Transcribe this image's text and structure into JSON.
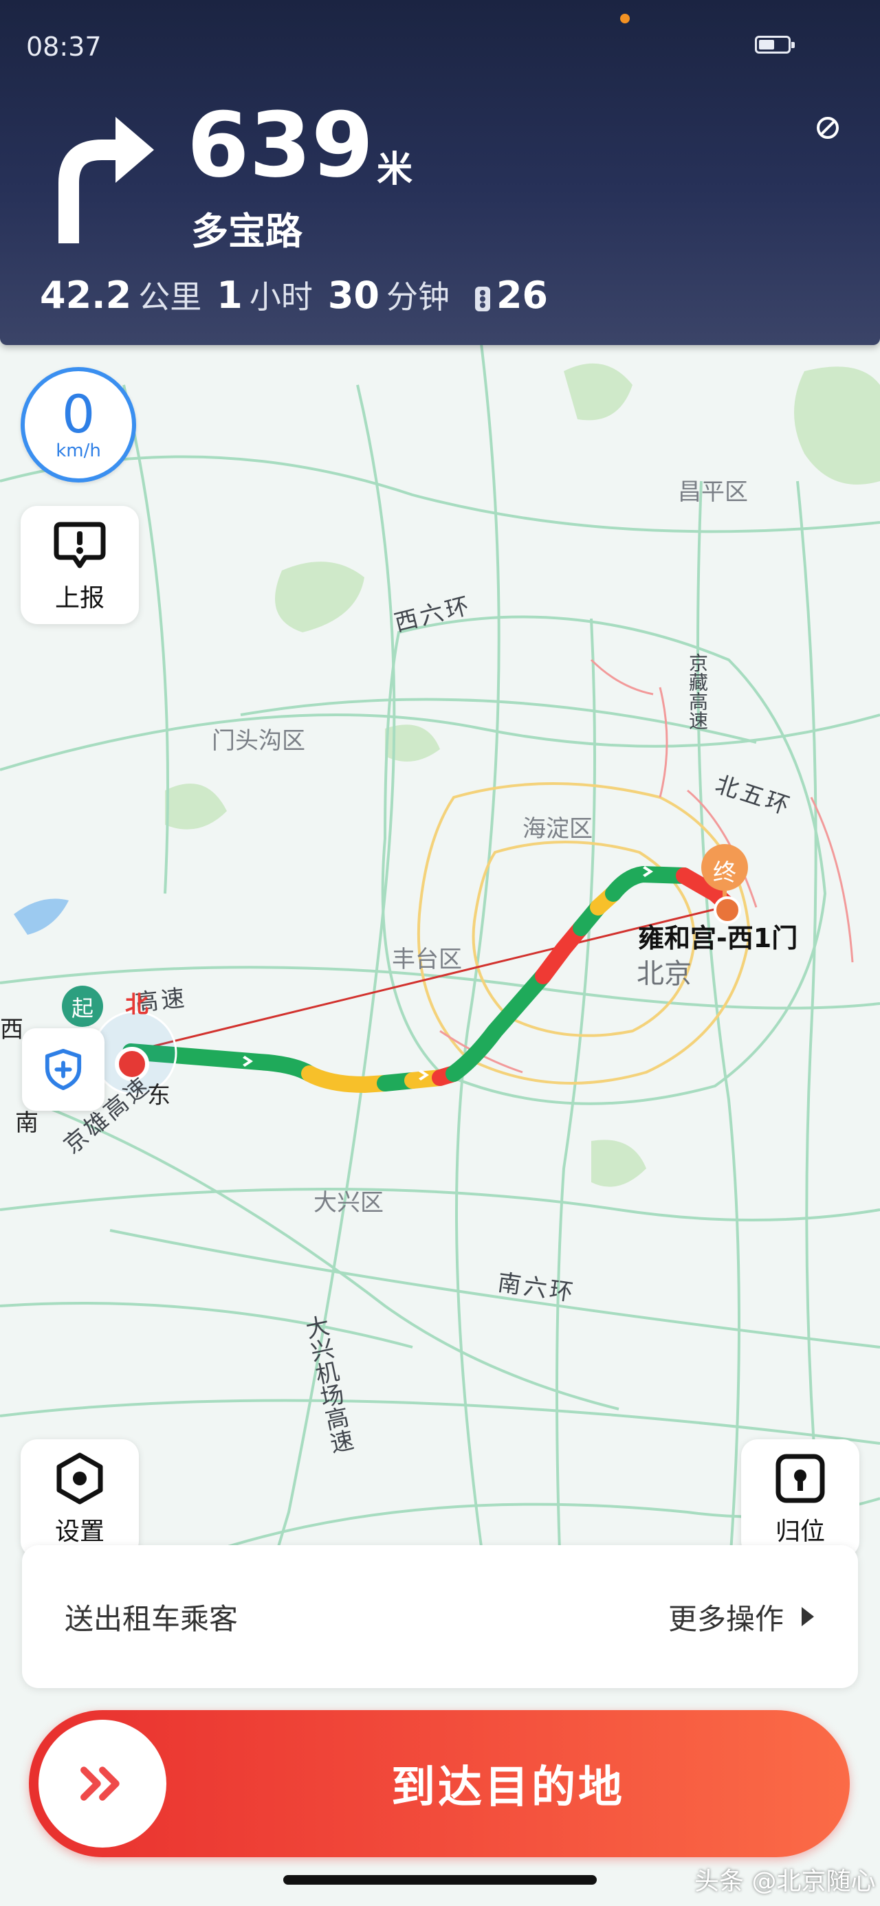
{
  "status_bar": {
    "time": "08:37"
  },
  "navigation": {
    "distance_value": "639",
    "distance_unit": "米",
    "next_road": "多宝路",
    "remaining_distance": "42.2",
    "remaining_distance_unit": "公里",
    "eta_hours": "1",
    "eta_hours_unit": "小时",
    "eta_minutes": "30",
    "eta_minutes_unit": "分钟",
    "traffic_lights": "26"
  },
  "speed": {
    "value": "0",
    "unit": "km/h"
  },
  "controls": {
    "report_label": "上报",
    "settings_label": "设置",
    "recenter_label": "归位"
  },
  "map": {
    "districts": [
      "昌平区",
      "门头沟区",
      "海淀区",
      "丰台区",
      "大兴区"
    ],
    "roads": [
      "西六环",
      "京藏高速",
      "北五环",
      "南六环",
      "大兴机场高速",
      "京雄高速",
      "高速"
    ],
    "start_marker": "起",
    "end_marker": "终",
    "destination": "雍和宫-西1门",
    "city": "北京",
    "compass": {
      "west": "西",
      "south": "南",
      "north": "北",
      "east": "东"
    },
    "traffic_colors": {
      "smooth": "#1faa5a",
      "slow": "#f7c02a",
      "congested": "#ef3a34",
      "severe": "#b8161f"
    }
  },
  "actions": {
    "drop_passenger": "送出租车乘客",
    "more_actions": "更多操作",
    "arrive": "到达目的地"
  },
  "watermark": "头条 @北京随心"
}
